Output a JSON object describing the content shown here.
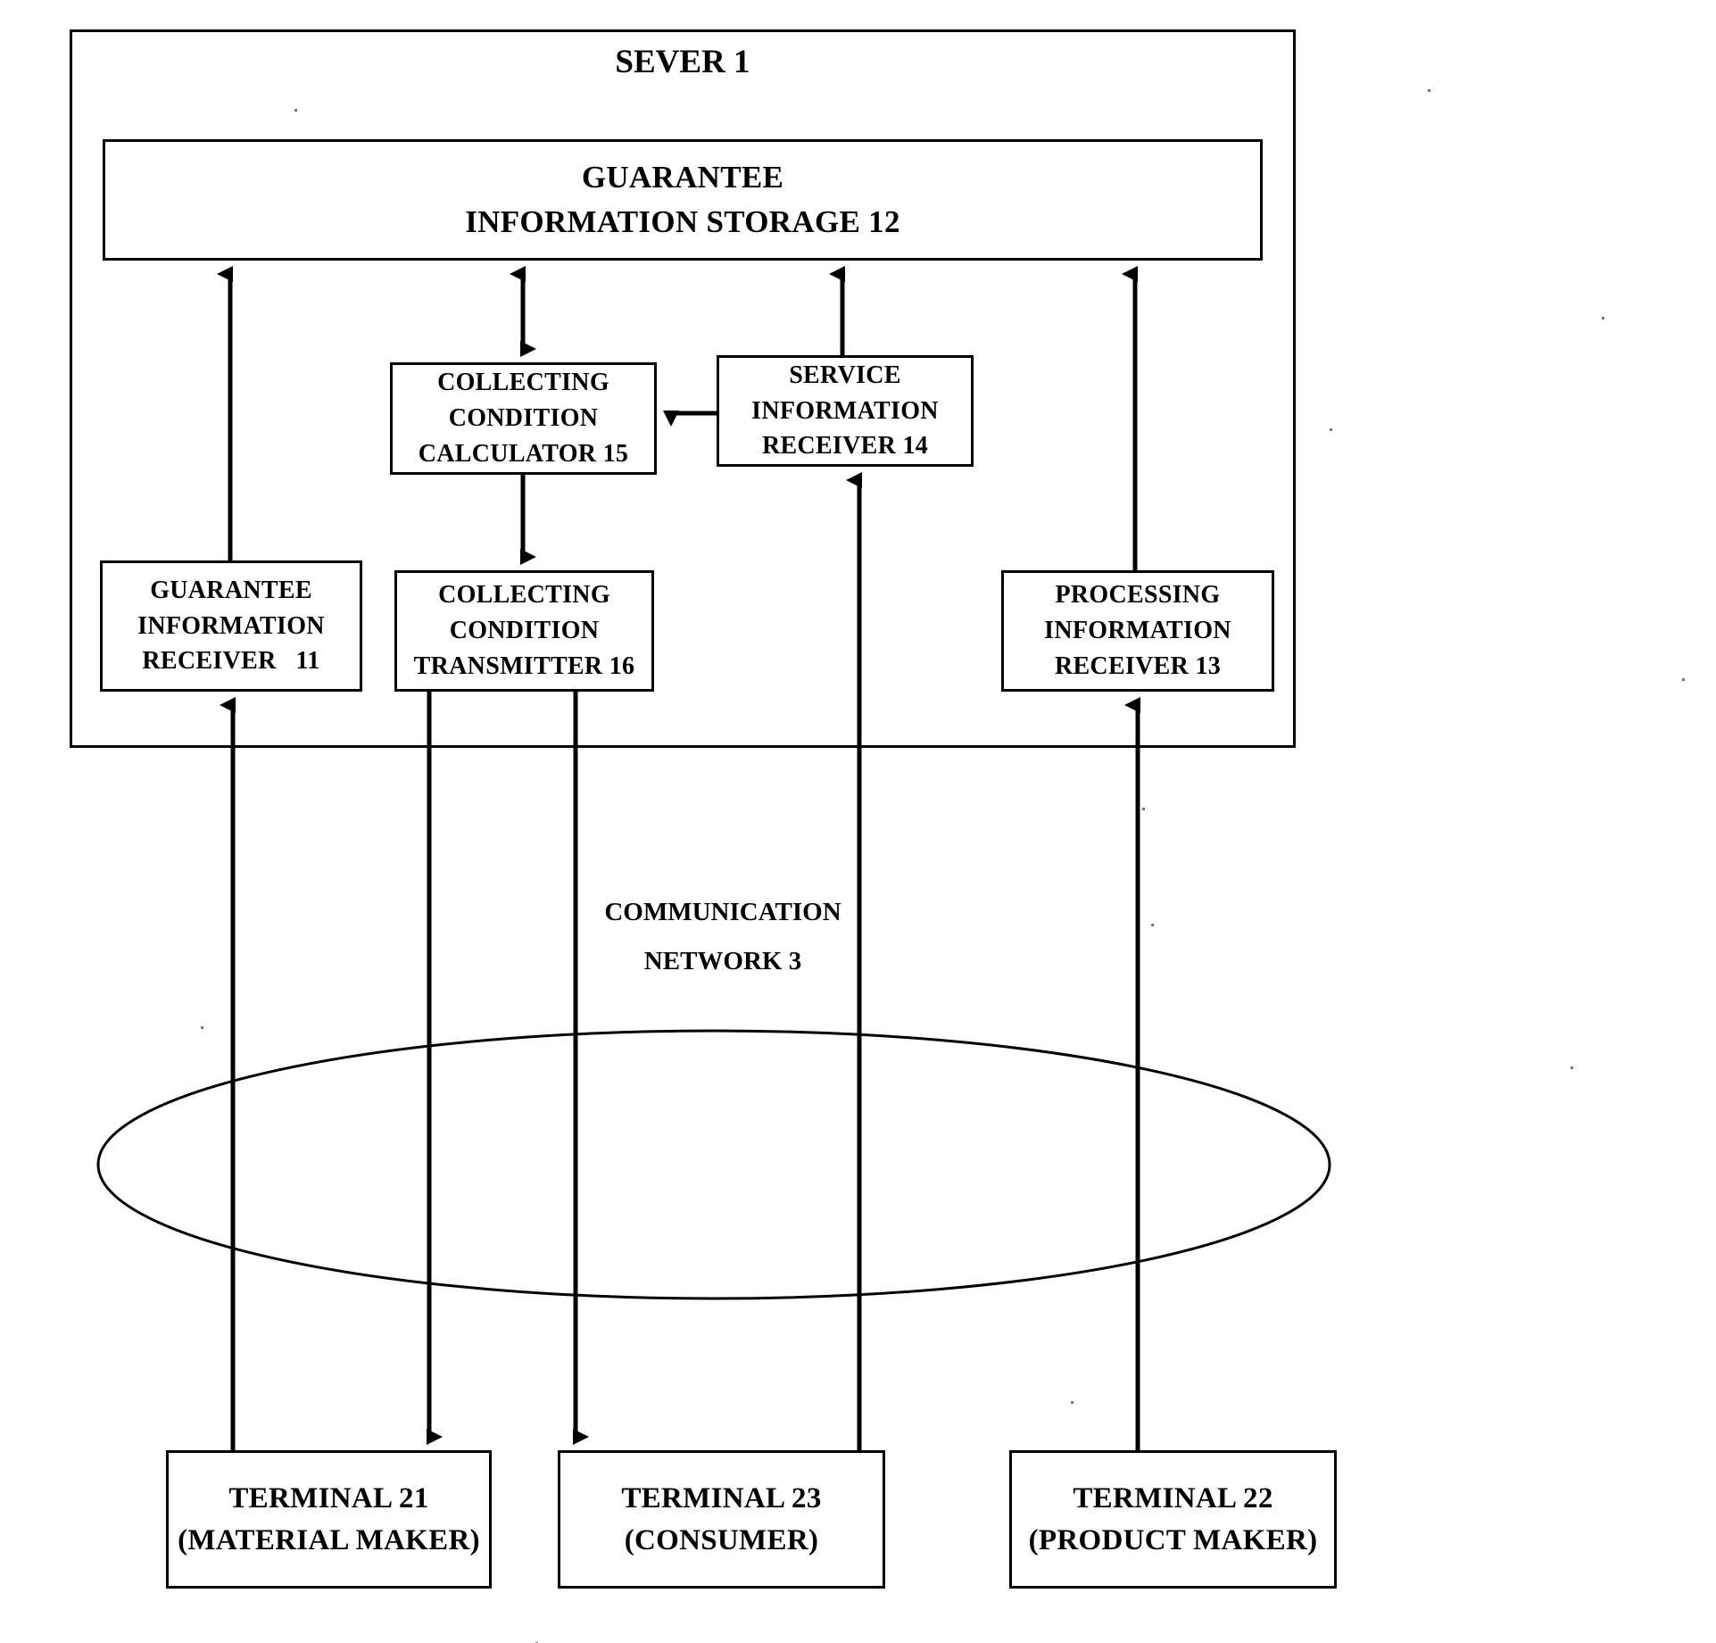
{
  "figure": {
    "type": "patent-block-diagram",
    "background_color": "#ffffff",
    "line_color": "#000000"
  },
  "server": {
    "title": "SEVER 1"
  },
  "blocks": {
    "guarantee_information_storage": {
      "id": "12",
      "lines": [
        "GUARANTEE",
        "INFORMATION STORAGE 12"
      ]
    },
    "collecting_condition_calculator": {
      "id": "15",
      "lines": [
        "COLLECTING",
        "CONDITION",
        "CALCULATOR 15"
      ]
    },
    "service_information_receiver": {
      "id": "14",
      "lines": [
        "SERVICE",
        "INFORMATION",
        "RECEIVER 14"
      ]
    },
    "guarantee_information_receiver": {
      "id": "11",
      "lines": [
        "GUARANTEE",
        "INFORMATION",
        "RECEIVER   11"
      ]
    },
    "collecting_condition_transmitter": {
      "id": "16",
      "lines": [
        "COLLECTING",
        "CONDITION",
        "TRANSMITTER 16"
      ]
    },
    "processing_information_receiver": {
      "id": "13",
      "lines": [
        "PROCESSING",
        "INFORMATION",
        "RECEIVER 13"
      ]
    }
  },
  "network": {
    "lines": [
      "COMMUNICATION",
      "NETWORK 3"
    ],
    "shape": "ellipse"
  },
  "terminals": {
    "terminal_21": {
      "lines": [
        "TERMINAL 21",
        "(MATERIAL MAKER)"
      ]
    },
    "terminal_23": {
      "lines": [
        "TERMINAL 23",
        "(CONSUMER)"
      ]
    },
    "terminal_22": {
      "lines": [
        "TERMINAL 22",
        "(PRODUCT MAKER)"
      ]
    }
  },
  "connectors": [
    {
      "name": "guarantee-receiver-to-storage",
      "direction": "up"
    },
    {
      "name": "storage-to-calculator",
      "direction": "both"
    },
    {
      "name": "service-receiver-to-storage",
      "direction": "up"
    },
    {
      "name": "processing-receiver-to-storage",
      "direction": "up"
    },
    {
      "name": "service-receiver-to-calculator",
      "direction": "left"
    },
    {
      "name": "calculator-to-transmitter",
      "direction": "down"
    },
    {
      "name": "terminal21-to-guarantee-receiver",
      "direction": "up"
    },
    {
      "name": "transmitter-to-terminal21",
      "direction": "down"
    },
    {
      "name": "transmitter-to-terminal23",
      "direction": "down"
    },
    {
      "name": "terminal23-to-service-receiver",
      "direction": "up"
    },
    {
      "name": "terminal22-to-processing-receiver",
      "direction": "up"
    }
  ]
}
